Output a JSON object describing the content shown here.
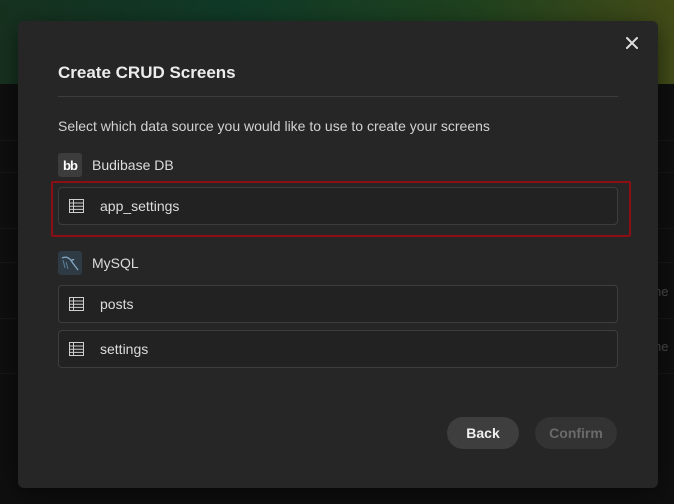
{
  "modal": {
    "title": "Create CRUD Screens",
    "description": "Select which data source you would like to use to create your screens",
    "close_icon": "close-icon"
  },
  "sources": [
    {
      "name": "Budibase DB",
      "logo_text": "bb",
      "tables": [
        {
          "label": "app_settings",
          "selected": true
        }
      ]
    },
    {
      "name": "MySQL",
      "logo": "mysql-dolphin-icon",
      "tables": [
        {
          "label": "posts"
        },
        {
          "label": "settings"
        }
      ]
    }
  ],
  "buttons": {
    "back": "Back",
    "confirm": "Confirm"
  },
  "background": {
    "peek_text_1": "he",
    "peek_text_2": "he"
  },
  "colors": {
    "highlight": "#8b0f14",
    "modal_bg": "#262626"
  }
}
